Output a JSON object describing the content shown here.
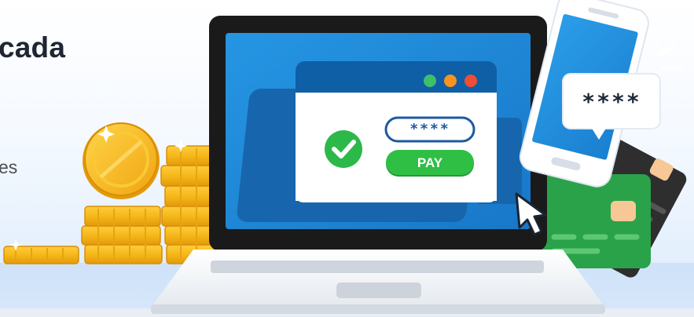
{
  "hero": {
    "headline": "cada",
    "subtext": "es"
  },
  "payment_window": {
    "password_mask": "****",
    "pay_label": "PAY",
    "window_dots": [
      "green-dot",
      "orange-dot",
      "red-dot"
    ]
  },
  "phone_bubble": {
    "password_mask": "****"
  },
  "icons": {
    "check": "check-circle-icon",
    "cursor": "mouse-pointer-icon",
    "coin": "coin-icon",
    "card": "credit-card-icon",
    "phone": "smartphone-icon",
    "laptop": "laptop-icon"
  },
  "colors": {
    "screen_blue": "#1e88d6",
    "pay_green": "#2fbf45",
    "check_green": "#2db84a",
    "coin_gold": "#f5b81a",
    "card_green": "#2aa24a",
    "card_black": "#2c2c2c",
    "laptop_frame": "#1a1a1a"
  }
}
